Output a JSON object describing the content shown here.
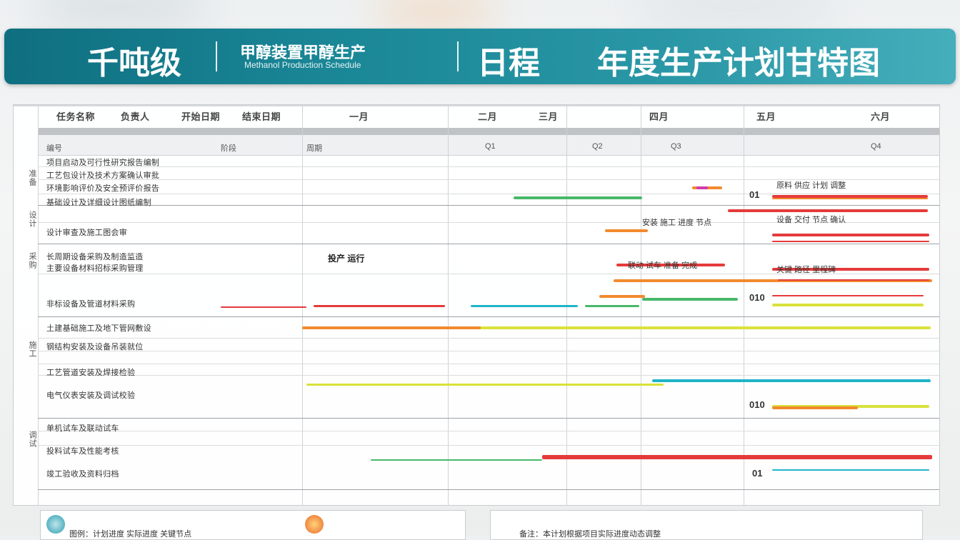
{
  "header": {
    "title_main": "千吨级",
    "title_sub_top": "甲醇装置甲醇生产",
    "title_sub_bottom": "Methanol Production Schedule",
    "title_mid": "日程",
    "title_right": "年度生产计划甘特图"
  },
  "columns": [
    "任务名称",
    "负责人",
    "开始日期",
    "结束日期",
    "一月",
    "二月",
    "三月",
    "四月",
    "五月",
    "六月"
  ],
  "subheads": [
    "编号",
    "阶段",
    "周期",
    "Q1",
    "Q2",
    "Q3",
    "Q4"
  ],
  "groups": [
    "准备",
    "设计",
    "采购",
    "施工",
    "调试"
  ],
  "rows": [
    "项目启动及可行性研究报告编制",
    "工艺包设计及技术方案确认审批",
    "环境影响评价及安全预评价报告",
    "基础设计及详细设计图纸编制",
    "设计审查及施工图会审",
    "长周期设备采购及制造监造",
    "主要设备材料招标采购管理",
    "非标设备及管道材料采购",
    "土建基础施工及地下管网敷设",
    "钢结构安装及设备吊装就位",
    "工艺管道安装及焊接检验",
    "电气仪表安装及调试校验",
    "单机试车及联动试车",
    "投料试车及性能考核",
    "竣工验收及资料归档"
  ],
  "notes": {
    "n1": "原料 供应 计划 调整",
    "n2": "设备 交付 节点 确认",
    "n3": "关键 路径 里程碑",
    "n4": "安装 施工 进度 节点",
    "n5": "联动 试车 准备 完成",
    "n6": "投产 运行",
    "m1": "01",
    "m2": "010",
    "m3": "010",
    "m4": "01"
  },
  "bottom": {
    "left_text": "图例：计划进度 实际进度 关键节点",
    "right_text": "备注：本计划根据项目实际进度动态调整"
  },
  "colors": {
    "banner_start": "#0f6f80",
    "banner_end": "#45aebb",
    "red": "#e53a3a",
    "orange": "#f28a2e",
    "green": "#48b86a",
    "yellow": "#d9e23a",
    "teal": "#1fb5c9",
    "magenta": "#d13ab0"
  }
}
